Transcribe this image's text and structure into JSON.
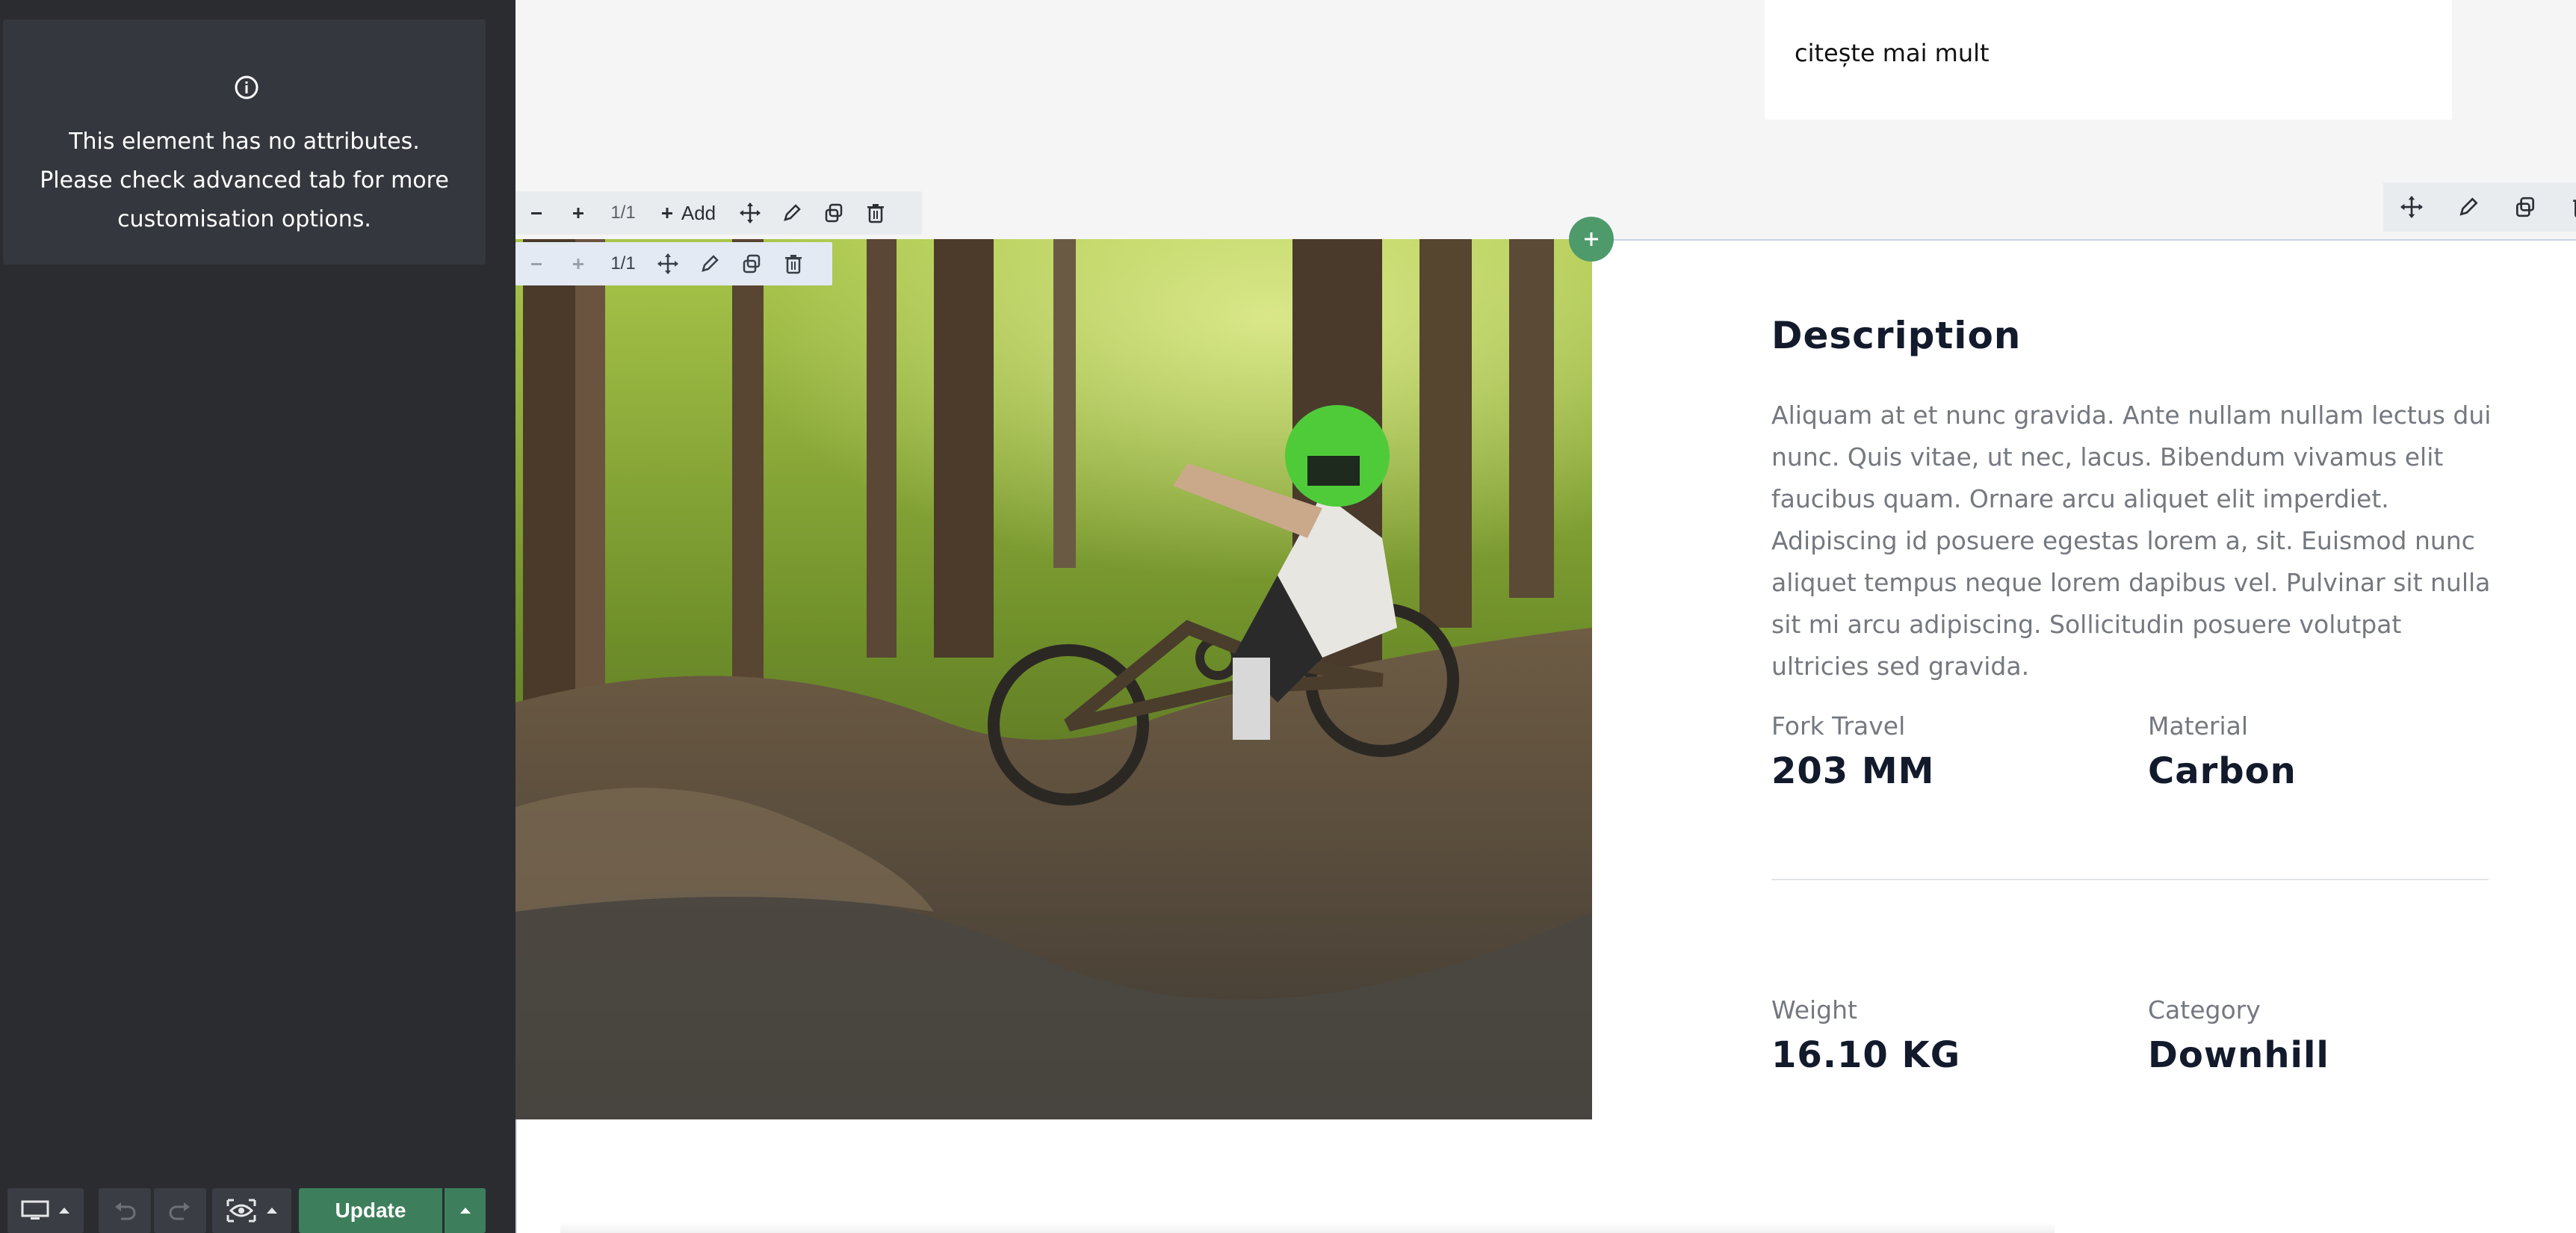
{
  "sidebar": {
    "notice_text": "This element has no attributes. Please check advanced tab for more customisation options.",
    "icon": "info-icon"
  },
  "bottom_bar": {
    "device_icon": "desktop-icon",
    "undo_icon": "undo-icon",
    "redo_icon": "redo-icon",
    "preview_icon": "eye-preview-icon",
    "update_label": "Update"
  },
  "top_card": {
    "link_text": "citește mai mult"
  },
  "toolbar_row": {
    "fraction": "1/1",
    "add_label": "Add"
  },
  "toolbar_column": {
    "fraction": "1/1"
  },
  "section": {
    "title": "Description",
    "body": "Aliquam at et nunc gravida. Ante nullam nullam lectus dui nunc. Quis vitae, ut nec, lacus. Bibendum vivamus elit faucibus quam. Ornare arcu aliquet elit imperdiet. Adipiscing id posuere egestas lorem a, sit. Euismod nunc aliquet tempus neque lorem dapibus vel. Pulvinar sit nulla sit mi arcu adipiscing. Sollicitudin posuere volutpat ultricies sed gravida.",
    "specs": [
      {
        "label": "Fork Travel",
        "value": "203 MM"
      },
      {
        "label": "Material",
        "value": "Carbon"
      },
      {
        "label": "Weight",
        "value": "16.10 KG"
      },
      {
        "label": "Category",
        "value": "Downhill"
      }
    ]
  },
  "colors": {
    "sidebar_bg": "#2a2c30",
    "accent_green": "#3d7f5c",
    "heading": "#121a2c",
    "muted_text": "#74787f"
  }
}
